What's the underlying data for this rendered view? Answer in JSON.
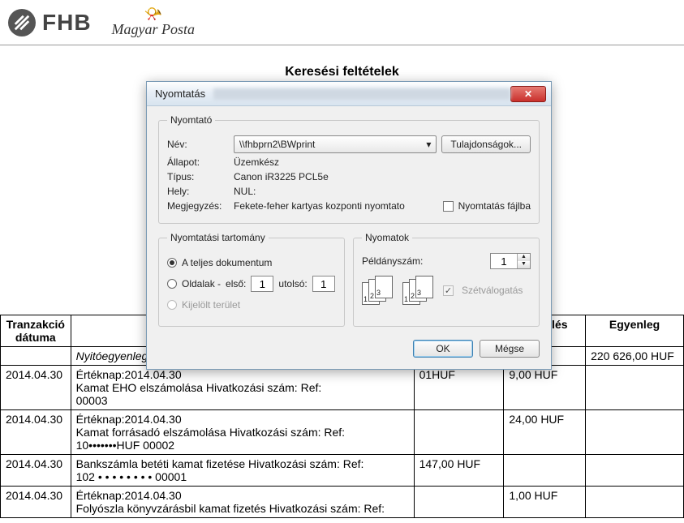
{
  "header": {
    "fhb_label": "FHB",
    "magyar_posta_label": "Magyar Posta"
  },
  "page": {
    "title": "Keresési feltételek"
  },
  "dialog": {
    "title": "Nyomtatás",
    "printer_group": "Nyomtató",
    "name_label": "Név:",
    "printer_name": "\\\\fhbprn2\\BWprint",
    "properties_btn": "Tulajdonságok...",
    "status_label": "Állapot:",
    "status_value": "Üzemkész",
    "type_label": "Típus:",
    "type_value": "Canon iR3225 PCL5e",
    "location_label": "Hely:",
    "location_value": "NUL:",
    "comment_label": "Megjegyzés:",
    "comment_value": "Fekete-feher kartyas kozponti nyomtato",
    "print_to_file": "Nyomtatás fájlba",
    "range_group": "Nyomtatási tartomány",
    "range_all": "A teljes dokumentum",
    "range_pages": "Oldalak -",
    "range_first": "első:",
    "range_first_val": "1",
    "range_last": "utolsó:",
    "range_last_val": "1",
    "range_selection": "Kijelölt terület",
    "copies_group": "Nyomatok",
    "copies_label": "Példányszám:",
    "copies_val": "1",
    "collate": "Szétválogatás",
    "ok_btn": "OK",
    "cancel_btn": "Mégse"
  },
  "table": {
    "headers": {
      "date": "Tranzakció dátuma",
      "debit": "Terhelés",
      "balance": "Egyenleg"
    },
    "rows": [
      {
        "date": "",
        "desc": "Nyitóegyenleg",
        "amount": "",
        "debit": "",
        "balance": "220 626,00 HUF",
        "ital": true
      },
      {
        "date": "2014.04.30",
        "desc": "Értéknap:2014.04.30\nKamat EHO elszámolása Hivatkozási szám: Ref:\n00003",
        "amount": "01HUF",
        "debit": "9,00 HUF",
        "balance": ""
      },
      {
        "date": "2014.04.30",
        "desc": "Értéknap:2014.04.30\nKamat forrásadó elszámolása Hivatkozási szám: Ref:\n10•••••••HUF 00002",
        "amount": "",
        "debit": "24,00 HUF",
        "balance": ""
      },
      {
        "date": "2014.04.30",
        "desc": "Bankszámla betéti kamat fizetése Hivatkozási szám: Ref:\n102 • • • • • • • • 00001",
        "amount": "147,00 HUF",
        "debit": "",
        "balance": ""
      },
      {
        "date": "2014.04.30",
        "desc": "Értéknap:2014.04.30\nFolyószla könyvzárásbil kamat fizetés Hivatkozási szám: Ref:",
        "amount": "",
        "debit": "1,00 HUF",
        "balance": ""
      }
    ]
  }
}
